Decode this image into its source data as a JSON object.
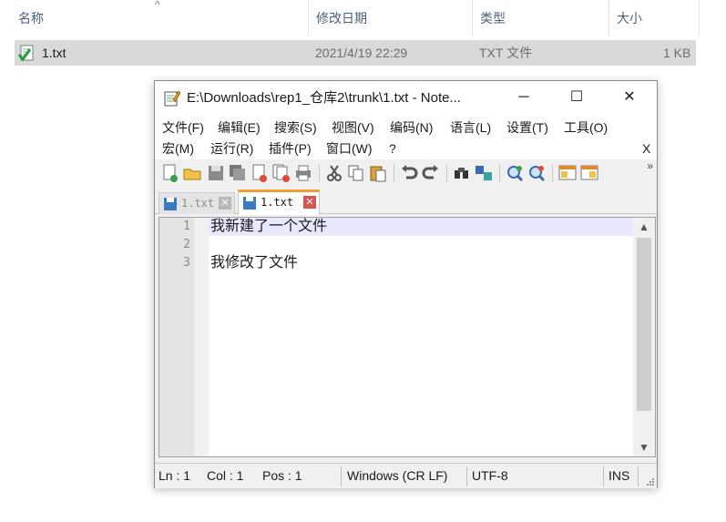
{
  "explorer": {
    "columns": {
      "name": "名称",
      "modified": "修改日期",
      "type": "类型",
      "size": "大小"
    },
    "sort_indicator": "^",
    "files": [
      {
        "name": "1.txt",
        "modified": "2021/4/19 22:29",
        "type": "TXT 文件",
        "size": "1 KB",
        "icon": "text-file-icon"
      }
    ]
  },
  "notepad": {
    "title": "E:\\Downloads\\rep1_仓库2\\trunk\\1.txt - Note...",
    "window_buttons": {
      "minimize": "─",
      "maximize": "☐",
      "close": "✕"
    },
    "menu_row1": [
      "文件(F)",
      "编辑(E)",
      "搜索(S)",
      "视图(V)",
      "编码(N)",
      "语言(L)",
      "设置(T)",
      "工具(O)"
    ],
    "menu_row2": [
      "宏(M)",
      "运行(R)",
      "插件(P)",
      "窗口(W)",
      "?"
    ],
    "menu_close": "X",
    "toolbar_more": "»",
    "tabs": [
      {
        "label": "1.txt",
        "active": false
      },
      {
        "label": "1.txt",
        "active": true
      }
    ],
    "tab_close": "✕",
    "lines": [
      {
        "num": "1",
        "text": "我新建了一个文件"
      },
      {
        "num": "2",
        "text": ""
      },
      {
        "num": "3",
        "text": "我修改了文件"
      }
    ],
    "scroll_up": "▲",
    "scroll_down": "▼",
    "status": {
      "ln": "Ln : 1",
      "col": "Col : 1",
      "pos": "Pos : 1",
      "eol": "Windows (CR LF)",
      "encoding": "UTF-8",
      "mode": "INS"
    }
  },
  "colors": {
    "selection_row": "#d9d9d9",
    "active_tab_accent": "#f0a030",
    "current_line": "#e8e8ff"
  }
}
